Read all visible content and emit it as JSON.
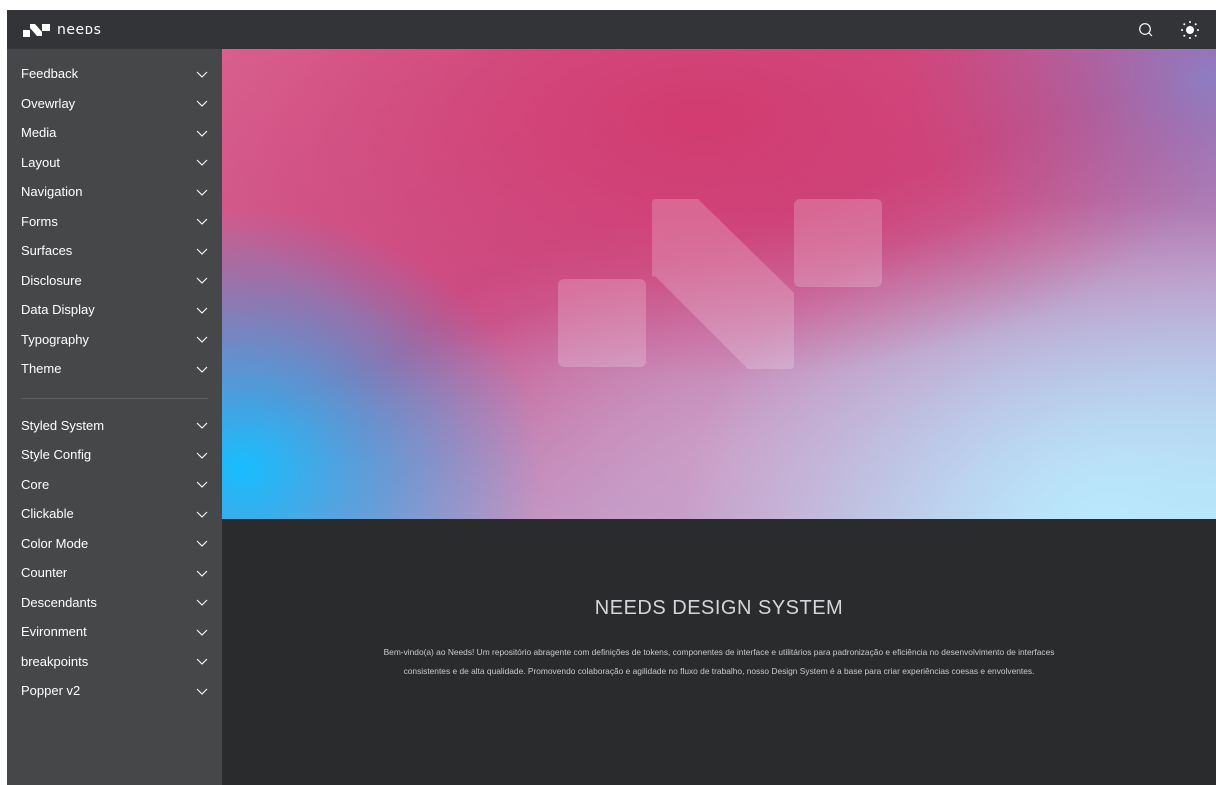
{
  "app": {
    "logo_text": "neeᴅs"
  },
  "topbar": {
    "icons": [
      "search-icon",
      "sun-icon"
    ]
  },
  "sidebar": {
    "group1": [
      "Feedback",
      "Ovewrlay",
      "Media",
      "Layout",
      "Navigation",
      "Forms",
      "Surfaces",
      "Disclosure",
      "Data Display",
      "Typography",
      "Theme"
    ],
    "group2": [
      "Styled System",
      "Style Config",
      "Core",
      "Clickable",
      "Color Mode",
      "Counter",
      "Descendants",
      "Evironment",
      "breakpoints",
      "Popper v2"
    ]
  },
  "main": {
    "title": "NEEDS DESIGN SYSTEM",
    "description": "Bem-vindo(a) ao Needs! Um repositório abragente com definições de tokens, componentes de interface e utilitários para padronização e eficiência no desenvolvimento de interfaces consistentes e de alta qualidade. Promovendo colaboração e agilidade no fluxo de trabalho, nosso Design System é a base para criar experiências coesas e envolventes."
  },
  "colors": {
    "topbar": "#333437",
    "sidebar": "#464749",
    "content_bg": "#2a2b2d",
    "hero_pink": "#d23a6e",
    "hero_cyan": "#18beff"
  }
}
